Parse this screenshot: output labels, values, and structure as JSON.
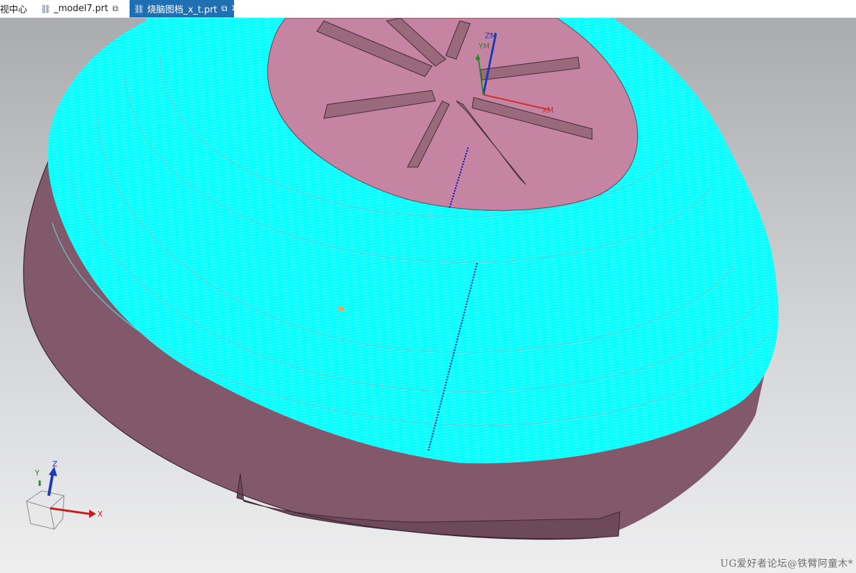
{
  "tabs": [
    {
      "label": "视中心",
      "icon": "",
      "active": false
    },
    {
      "label": "_model7.prt",
      "icon": "part-file-icon",
      "action_icon": "external-link-icon",
      "active": false
    },
    {
      "label": "烧脑图档_x_t.prt",
      "icon": "part-file-icon",
      "action_icon": "external-link-icon",
      "active": true
    }
  ],
  "close_glyph": "✕",
  "csys": {
    "xm": "XM",
    "ym": "YM",
    "zm": "ZM"
  },
  "triad": {
    "x": "X",
    "y": "Y",
    "z": "Z"
  },
  "watermark": "UG爱好者论坛@铁臂阿童木*",
  "colors": {
    "toolpath": "#00ffff",
    "part": "#8a5a6c",
    "floor": "#c58ca3",
    "tab_active": "#1f6fb3",
    "cut_path": "#0000cc"
  }
}
